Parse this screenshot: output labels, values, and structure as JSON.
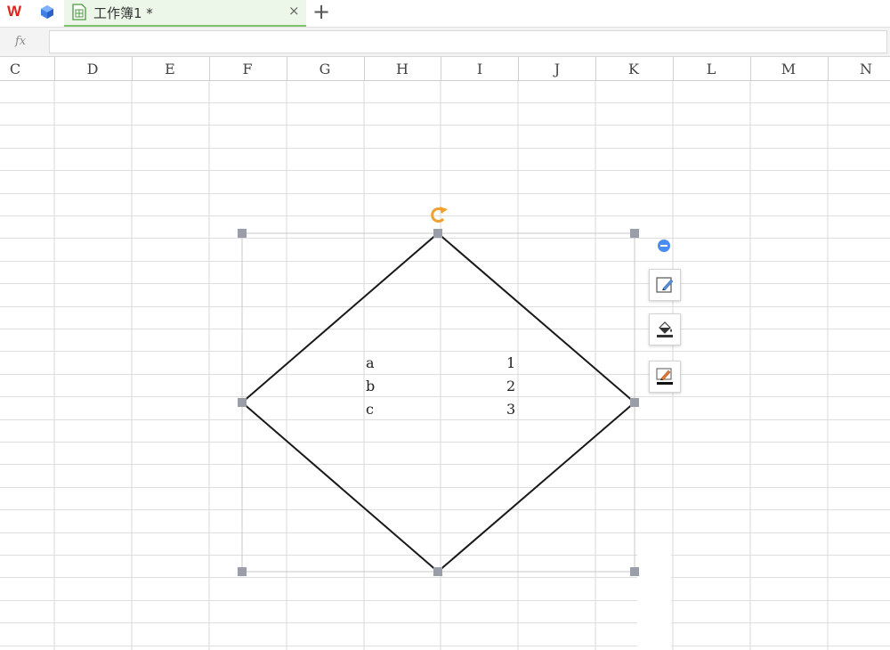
{
  "tab": {
    "title": "工作簿1 *",
    "close_glyph": "×",
    "new_tab_glyph": "+"
  },
  "formula_bar": {
    "fx_label": "fx",
    "value": ""
  },
  "columns": [
    "C",
    "D",
    "E",
    "F",
    "G",
    "H",
    "I",
    "J",
    "K",
    "L",
    "M",
    "N"
  ],
  "cells": [
    {
      "label": "a",
      "value": "1"
    },
    {
      "label": "b",
      "value": "2"
    },
    {
      "label": "c",
      "value": "3"
    }
  ],
  "icons": {
    "logo": "wps-logo-icon",
    "cloud": "cloud-cube-icon",
    "sheet_file": "spreadsheet-file-icon",
    "rotate": "rotate-handle-icon",
    "collapse": "collapse-toolbar-icon",
    "shape_style": "shape-style-icon",
    "fill": "fill-bucket-icon",
    "outline": "outline-pen-icon"
  },
  "colors": {
    "accent_green": "#7cc26c",
    "tab_background": "#ecf7e9",
    "logo_red": "#e2231a",
    "handle_gray": "#9a9ea8",
    "rotate_orange": "#f0a030",
    "collapse_blue": "#4a8cf0"
  }
}
